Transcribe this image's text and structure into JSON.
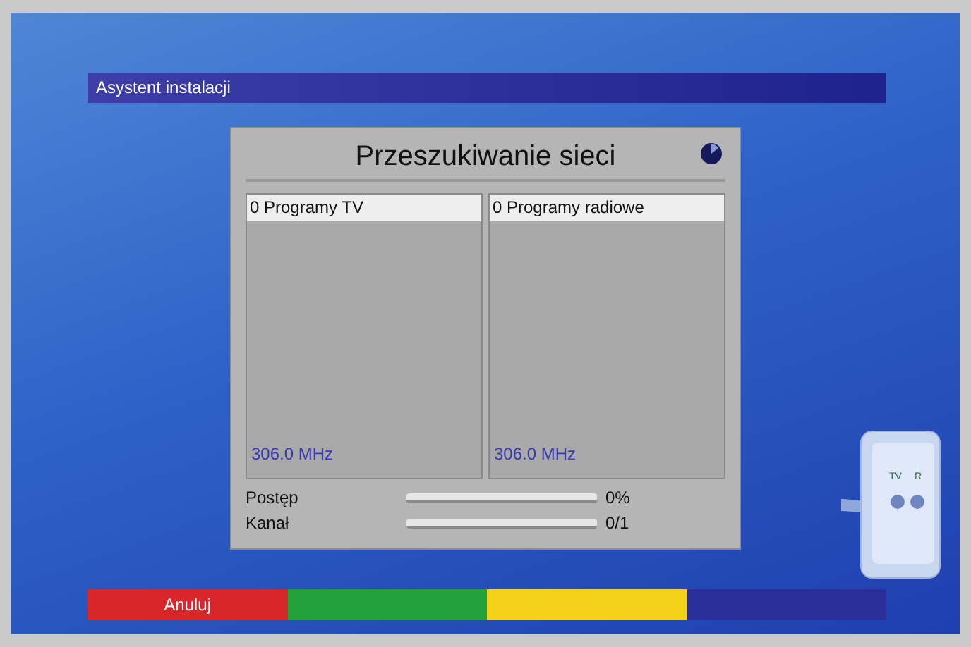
{
  "header": {
    "title": "Asystent instalacji"
  },
  "dialog": {
    "title": "Przeszukiwanie sieci",
    "panels": [
      {
        "header": "0 Programy TV",
        "frequency": "306.0 MHz"
      },
      {
        "header": "0 Programy radiowe",
        "frequency": "306.0 MHz"
      }
    ],
    "progress": [
      {
        "label": "Postęp",
        "level": 0,
        "reading": "0%"
      },
      {
        "label": "Kanał",
        "level": 0,
        "reading": "0/1"
      }
    ]
  },
  "socket": {
    "labels": [
      "TV",
      "R"
    ]
  },
  "color_keys": [
    {
      "label": "Anuluj",
      "color": "#d8262b"
    },
    {
      "color": "#22a13b"
    },
    {
      "color": "#f4d21a"
    },
    {
      "color": "#2a2f9a"
    }
  ]
}
